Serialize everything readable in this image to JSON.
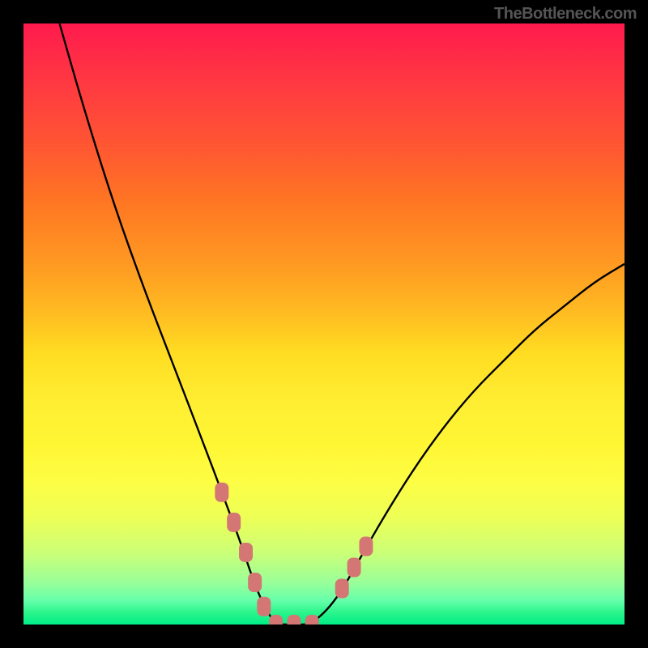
{
  "watermark": "TheBottleneck.com",
  "chart_data": {
    "type": "line",
    "title": "",
    "xlabel": "",
    "ylabel": "",
    "xlim": [
      0,
      100
    ],
    "ylim": [
      0,
      100
    ],
    "series": [
      {
        "name": "curve",
        "x": [
          6,
          10,
          15,
          20,
          25,
          30,
          33,
          36,
          38,
          40,
          42,
          45,
          48,
          52,
          56,
          60,
          65,
          70,
          75,
          80,
          85,
          90,
          95,
          100
        ],
        "y": [
          100,
          86,
          70,
          56,
          43,
          30,
          22,
          14,
          8,
          3,
          0,
          0,
          0,
          4,
          11,
          18,
          26,
          33,
          39,
          44,
          49,
          53,
          57,
          60
        ]
      }
    ],
    "markers": [
      {
        "name": "marker-set-left",
        "x": [
          33,
          35,
          37,
          38.5,
          40
        ],
        "y": [
          22,
          17,
          12,
          7,
          3
        ]
      },
      {
        "name": "marker-set-bottom",
        "x": [
          42,
          45,
          48
        ],
        "y": [
          0,
          0,
          0
        ]
      },
      {
        "name": "marker-set-right",
        "x": [
          53,
          55,
          57
        ],
        "y": [
          6,
          9.5,
          13
        ]
      }
    ],
    "marker_color": "#d47774",
    "curve_color": "#000000"
  }
}
